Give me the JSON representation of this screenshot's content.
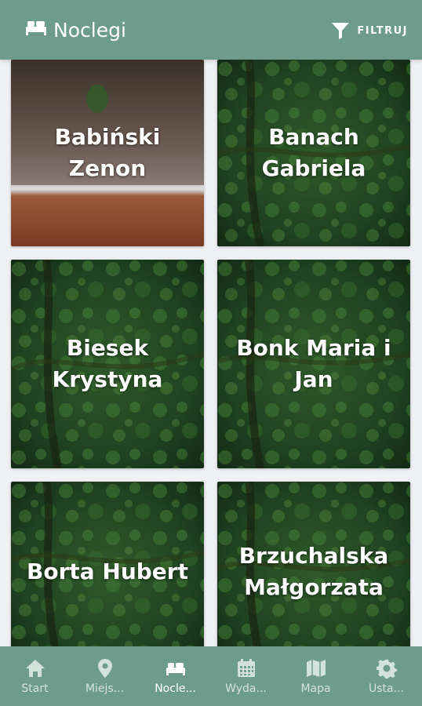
{
  "header": {
    "title": "Noclegi",
    "title_icon": "bed-icon",
    "filter_label": "FILTRUJ",
    "filter_icon": "filter-icon"
  },
  "cards": [
    {
      "name": "Babiński\nZenon",
      "image": "field-landscape"
    },
    {
      "name": "Banach\nGabriela",
      "image": "forest"
    },
    {
      "name": "Biesek\nKrystyna",
      "image": "forest"
    },
    {
      "name": "Bonk Maria i\nJan",
      "image": "forest"
    },
    {
      "name": "Borta Hubert",
      "image": "forest"
    },
    {
      "name": "Brzuchalska\nMałgorzata",
      "image": "forest"
    }
  ],
  "nav": {
    "items": [
      {
        "label": "Start",
        "icon": "home-icon"
      },
      {
        "label": "Miejs...",
        "icon": "map-pin-icon"
      },
      {
        "label": "Nocle...",
        "icon": "bed-icon",
        "active": true
      },
      {
        "label": "Wyda...",
        "icon": "calendar-icon"
      },
      {
        "label": "Mapa",
        "icon": "map-icon"
      },
      {
        "label": "Usta...",
        "icon": "gear-icon"
      }
    ]
  },
  "colors": {
    "primary": "#6e9c8c",
    "background": "#eef0f3",
    "nav_inactive": "#d3e3dc",
    "nav_active": "#ffffff"
  }
}
